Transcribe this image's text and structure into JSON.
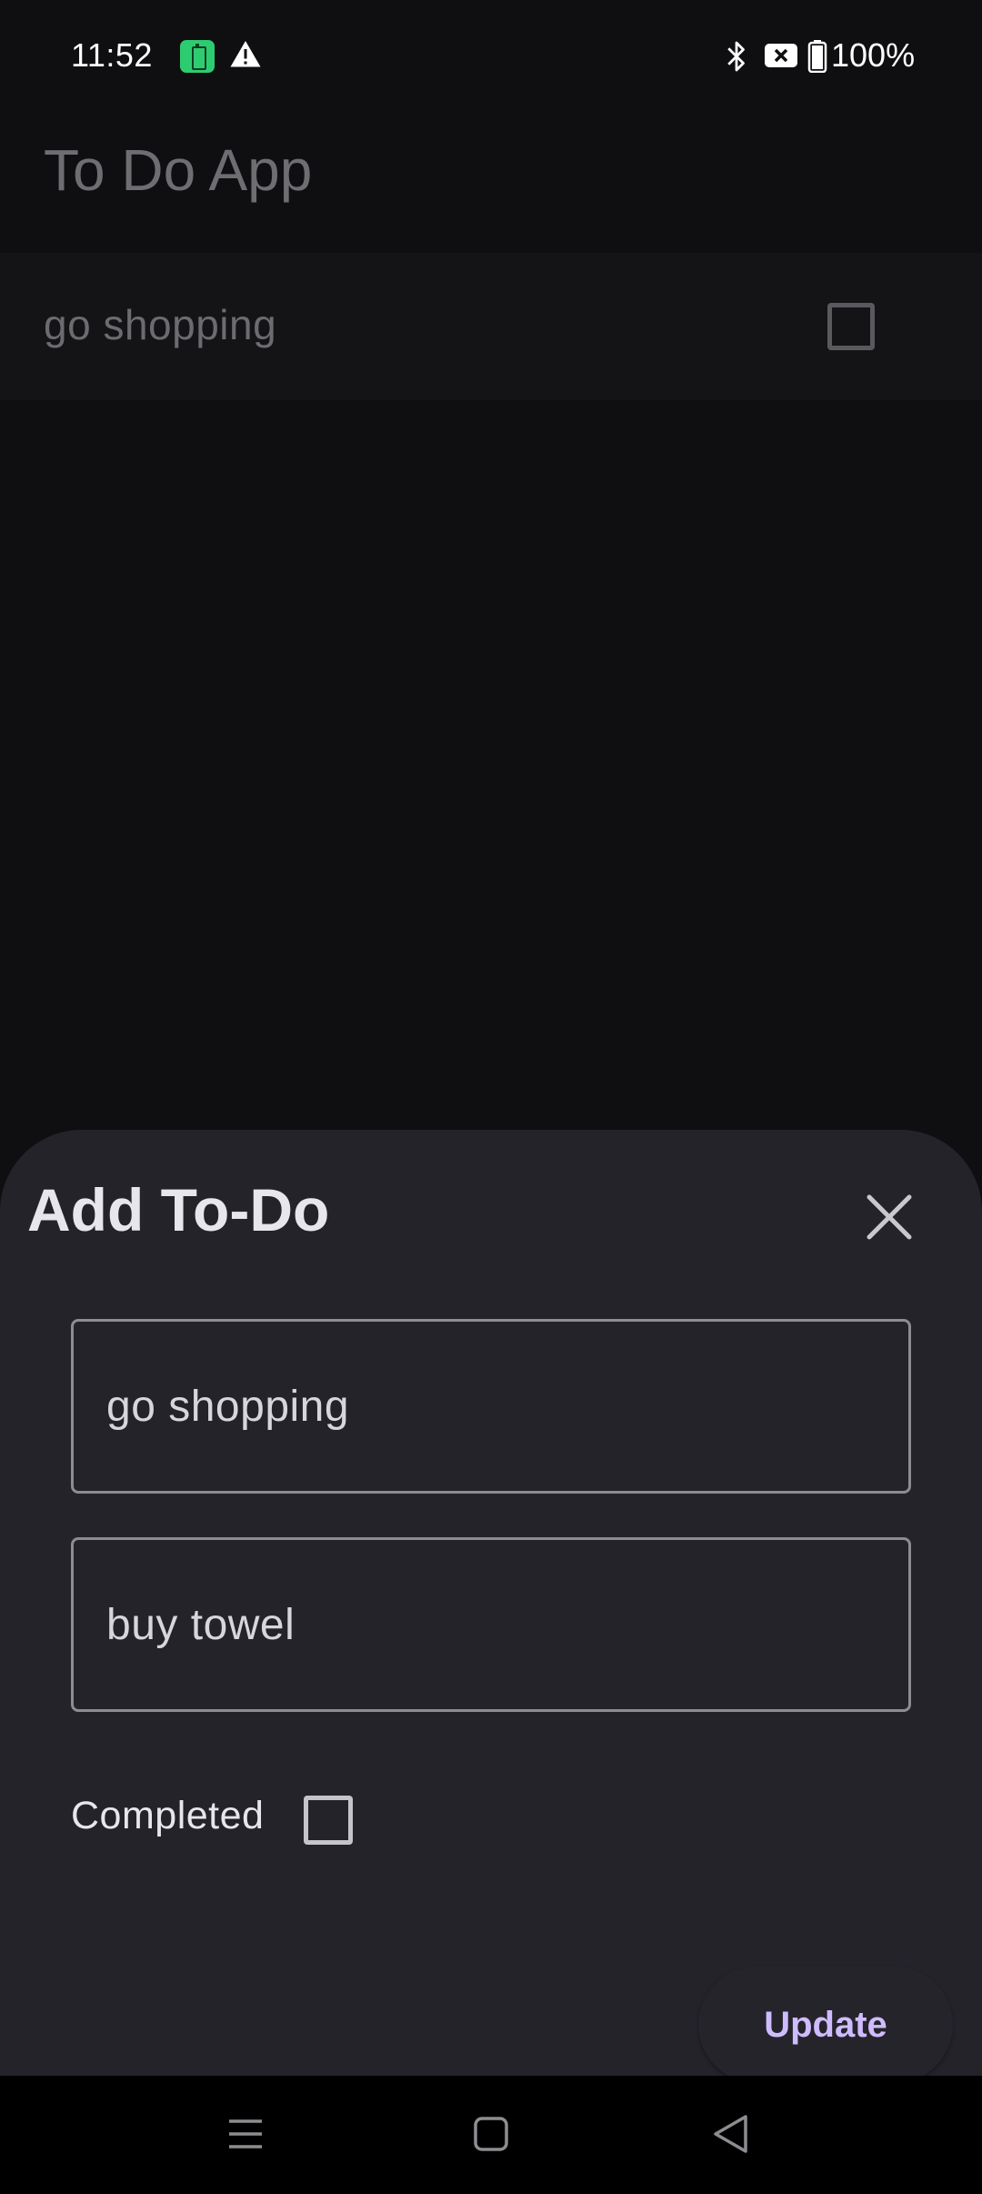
{
  "status_bar": {
    "time": "11:52",
    "battery_percent": "100%",
    "icons": [
      "battery-saver-icon",
      "alert-icon",
      "bluetooth-icon",
      "sim-icon",
      "battery-icon"
    ]
  },
  "app": {
    "title": "To Do App",
    "todos": [
      {
        "label": "go shopping",
        "completed": false
      }
    ]
  },
  "sheet": {
    "title": "Add To-Do",
    "title_field_value": "go shopping",
    "description_field_value": "buy towel",
    "completed_label": "Completed",
    "completed": false,
    "update_label": "Update"
  },
  "nav_bar": {
    "icons": [
      "menu-icon",
      "home-icon",
      "back-icon"
    ]
  },
  "colors": {
    "background": "#0f0f12",
    "sheet": "#24232a",
    "accent": "#cfbcff",
    "battery_saver": "#2ecc71"
  }
}
